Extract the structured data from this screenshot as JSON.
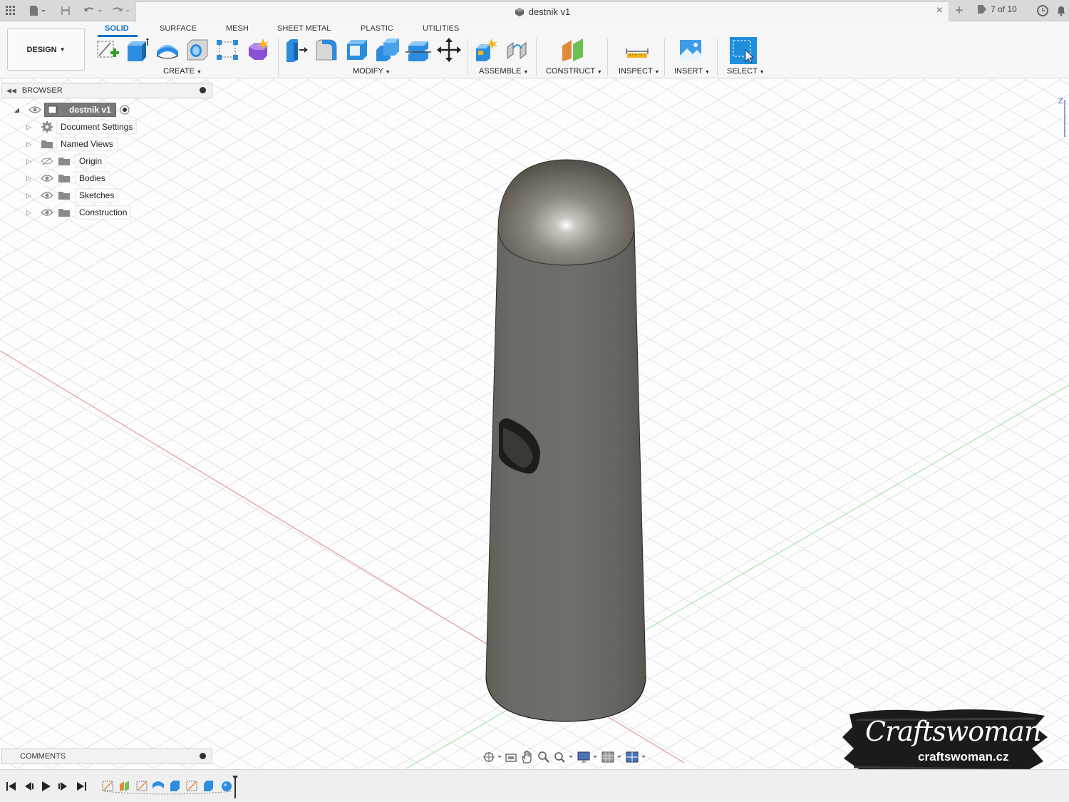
{
  "title_bar": {
    "document_title": "destnik v1",
    "job_status": "7 of 10"
  },
  "toolbar": {
    "workspace": "DESIGN",
    "tabs": [
      "SOLID",
      "SURFACE",
      "MESH",
      "SHEET METAL",
      "PLASTIC",
      "UTILITIES"
    ],
    "active_tab": "SOLID",
    "groups": {
      "create": "CREATE",
      "modify": "MODIFY",
      "assemble": "ASSEMBLE",
      "construct": "CONSTRUCT",
      "inspect": "INSPECT",
      "insert": "INSERT",
      "select": "SELECT"
    }
  },
  "browser": {
    "header": "BROWSER",
    "root": "destnik v1",
    "items": [
      "Document Settings",
      "Named Views",
      "Origin",
      "Bodies",
      "Sketches",
      "Construction"
    ]
  },
  "comments": {
    "header": "COMMENTS"
  },
  "viewcube": {
    "axis_label": "Z"
  },
  "watermark": {
    "brand": "Craftswoman",
    "url": "craftswoman.cz"
  },
  "colors": {
    "accent": "#0e6fc1",
    "x_axis": "#e06060",
    "y_axis": "#6ccf6c",
    "body": "#66655f"
  }
}
